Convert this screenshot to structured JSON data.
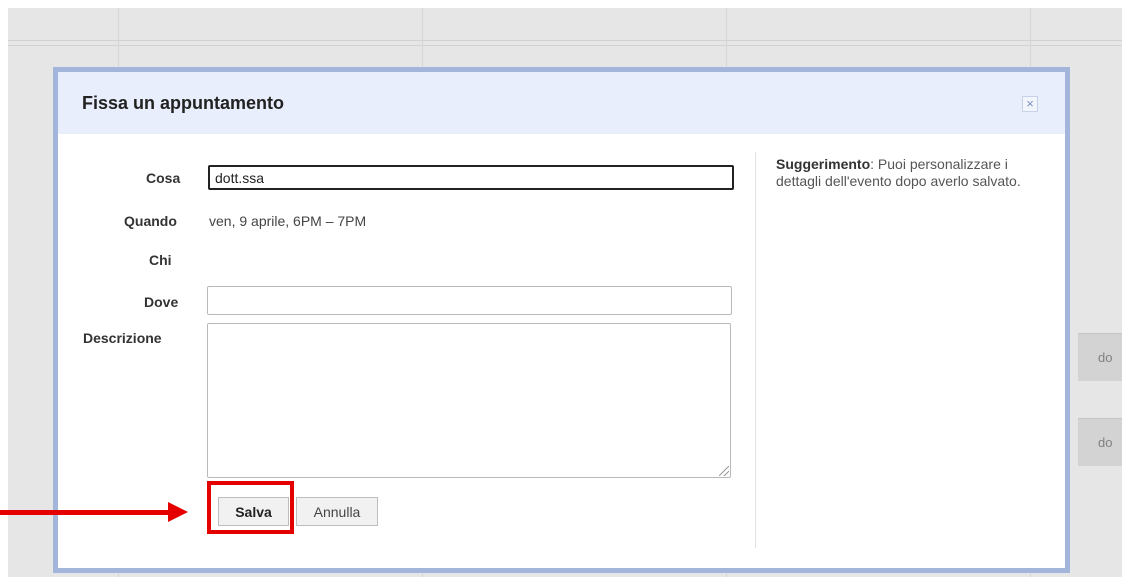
{
  "background": {
    "event_labels": [
      "do",
      "do"
    ]
  },
  "dialog": {
    "title": "Fissa un appuntamento",
    "close_symbol": "×",
    "fields": {
      "what_label": "Cosa",
      "what_value": "dott.ssa",
      "when_label": "Quando",
      "when_value": "ven, 9 aprile, 6PM – 7PM",
      "who_label": "Chi",
      "where_label": "Dove",
      "where_value": "",
      "description_label": "Descrizione",
      "description_value": ""
    },
    "tip": {
      "heading": "Suggerimento",
      "text": ": Puoi personalizzare i dettagli dell'evento dopo averlo salvato."
    },
    "buttons": {
      "save": "Salva",
      "cancel": "Annulla"
    }
  },
  "annotation": {
    "color": "#e50000",
    "target": "save-button"
  },
  "colors": {
    "dialog_border": "#a4b5dc",
    "dialog_header": "#e8eefb"
  }
}
